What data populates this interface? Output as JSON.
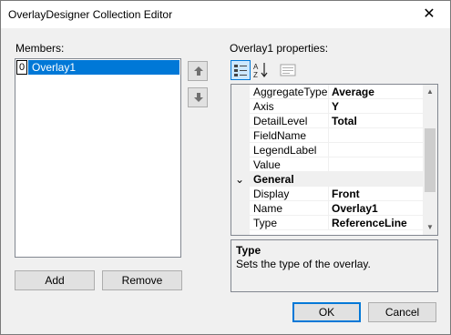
{
  "window": {
    "title": "OverlayDesigner Collection Editor",
    "close_glyph": "✕"
  },
  "members": {
    "label": "Members:",
    "items": [
      {
        "index": "0",
        "name": "Overlay1",
        "selected": true
      }
    ]
  },
  "move_buttons": {
    "up_icon": "arrow-up-icon",
    "down_icon": "arrow-down-icon"
  },
  "buttons": {
    "add": "Add",
    "remove": "Remove",
    "ok": "OK",
    "cancel": "Cancel"
  },
  "properties": {
    "label": "Overlay1 properties:",
    "toolbar": [
      "categorized-icon",
      "alphabetical-icon",
      "property-pages-icon"
    ],
    "rows": [
      {
        "name": "AggregateType",
        "value": "Average"
      },
      {
        "name": "Axis",
        "value": "Y"
      },
      {
        "name": "DetailLevel",
        "value": "Total"
      },
      {
        "name": "FieldName",
        "value": ""
      },
      {
        "name": "LegendLabel",
        "value": ""
      },
      {
        "name": "Value",
        "value": ""
      }
    ],
    "category": {
      "toggle": "⌄",
      "name": "General"
    },
    "general_rows": [
      {
        "name": "Display",
        "value": "Front"
      },
      {
        "name": "Name",
        "value": "Overlay1"
      },
      {
        "name": "Type",
        "value": "ReferenceLine"
      }
    ]
  },
  "description": {
    "title": "Type",
    "text": "Sets the type of the overlay."
  },
  "colors": {
    "selection": "#0078d7",
    "dialog_bg": "#f0f0f0",
    "button_bg": "#e1e1e1"
  }
}
